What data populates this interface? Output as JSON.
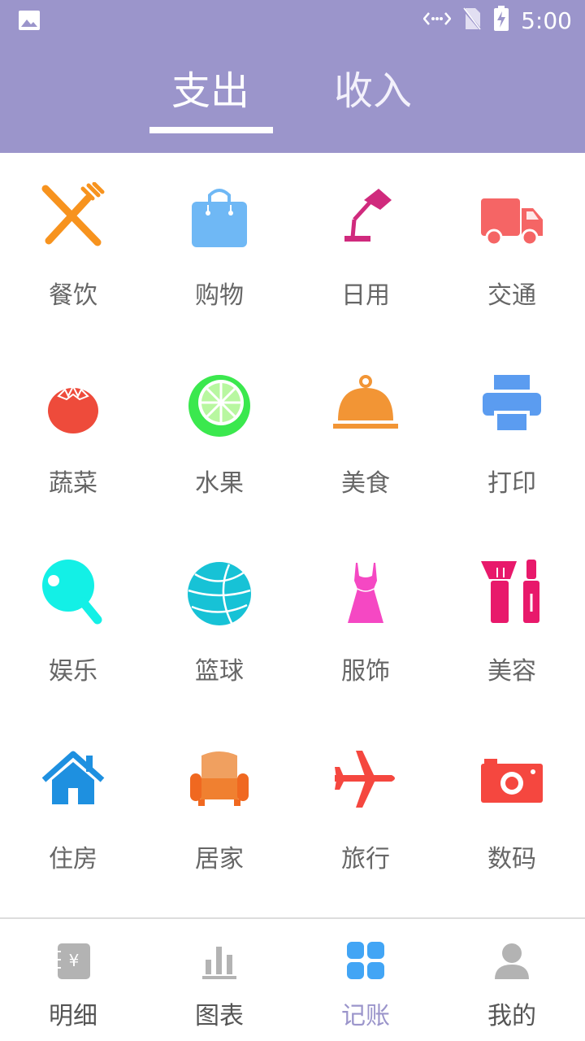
{
  "status_bar": {
    "time": "5:00",
    "icons": [
      "image-icon",
      "data-transfer-icon",
      "no-sim-icon",
      "battery-charging-icon"
    ]
  },
  "tabs": [
    {
      "label": "支出",
      "selected": true
    },
    {
      "label": "收入",
      "selected": false
    }
  ],
  "categories": [
    {
      "label": "餐饮",
      "icon": "utensils-icon",
      "color": "#F7931E"
    },
    {
      "label": "购物",
      "icon": "shopping-bag-icon",
      "color": "#6FB8F5"
    },
    {
      "label": "日用",
      "icon": "desk-lamp-icon",
      "color": "#D02A7D"
    },
    {
      "label": "交通",
      "icon": "truck-icon",
      "color": "#F56565"
    },
    {
      "label": "蔬菜",
      "icon": "tomato-icon",
      "color": "#EE4B3B"
    },
    {
      "label": "水果",
      "icon": "lime-icon",
      "color": "#3BE84E"
    },
    {
      "label": "美食",
      "icon": "food-cloche-icon",
      "color": "#F29535"
    },
    {
      "label": "打印",
      "icon": "printer-icon",
      "color": "#5B9CF0"
    },
    {
      "label": "娱乐",
      "icon": "ping-pong-icon",
      "color": "#13F0E6"
    },
    {
      "label": "篮球",
      "icon": "basketball-icon",
      "color": "#17C2D6"
    },
    {
      "label": "服饰",
      "icon": "dress-icon",
      "color": "#F548C3"
    },
    {
      "label": "美容",
      "icon": "cosmetics-icon",
      "color": "#E8196B"
    },
    {
      "label": "住房",
      "icon": "house-icon",
      "color": "#1E90E0"
    },
    {
      "label": "居家",
      "icon": "sofa-icon",
      "color": "#F08030"
    },
    {
      "label": "旅行",
      "icon": "airplane-icon",
      "color": "#F5473F"
    },
    {
      "label": "数码",
      "icon": "camera-icon",
      "color": "#F5473F"
    }
  ],
  "bottom_nav": [
    {
      "label": "明细",
      "icon": "ledger-icon",
      "active": false
    },
    {
      "label": "图表",
      "icon": "bar-chart-icon",
      "active": false
    },
    {
      "label": "记账",
      "icon": "grid-icon",
      "active": true
    },
    {
      "label": "我的",
      "icon": "user-icon",
      "active": false
    }
  ],
  "colors": {
    "header": "#9B95CB",
    "active_nav": "#9B95CB",
    "inactive_nav_icon": "#B3B3B3",
    "label_text": "#666666"
  }
}
